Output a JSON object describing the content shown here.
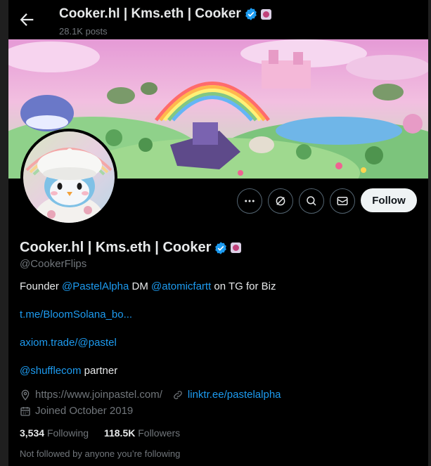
{
  "header": {
    "title": "Cooker.hl | Kms.eth | Cooker",
    "posts": "28.1K posts"
  },
  "profile": {
    "name": "Cooker.hl | Kms.eth | Cooker",
    "handle": "@CookerFlips",
    "bio": {
      "prefix": "Founder ",
      "mention1": "@PastelAlpha",
      "mid": " DM ",
      "mention2": "@atomicfartt",
      "suffix": " on TG for Biz"
    },
    "link1": "t.me/BloomSolana_bo...",
    "link2": "axiom.trade/@pastel",
    "partner_mention": "@shufflecom",
    "partner_suffix": " partner",
    "website": "https://www.joinpastel.com/",
    "website2": "linktr.ee/pastelalpha",
    "joined": "Joined October 2019",
    "following_count": "3,534",
    "following_label": "Following",
    "followers_count": "118.5K",
    "followers_label": "Followers",
    "followed_by": "Not followed by anyone you’re following"
  },
  "actions": {
    "follow_label": "Follow"
  },
  "colors": {
    "accent": "#1d9bf0",
    "background": "#000000",
    "muted": "#71767b"
  },
  "icons": [
    "back-arrow-icon",
    "verified-badge-icon",
    "affiliate-badge-icon",
    "more-icon",
    "grok-icon",
    "search-icon",
    "message-icon",
    "location-icon",
    "link-icon",
    "calendar-icon"
  ]
}
